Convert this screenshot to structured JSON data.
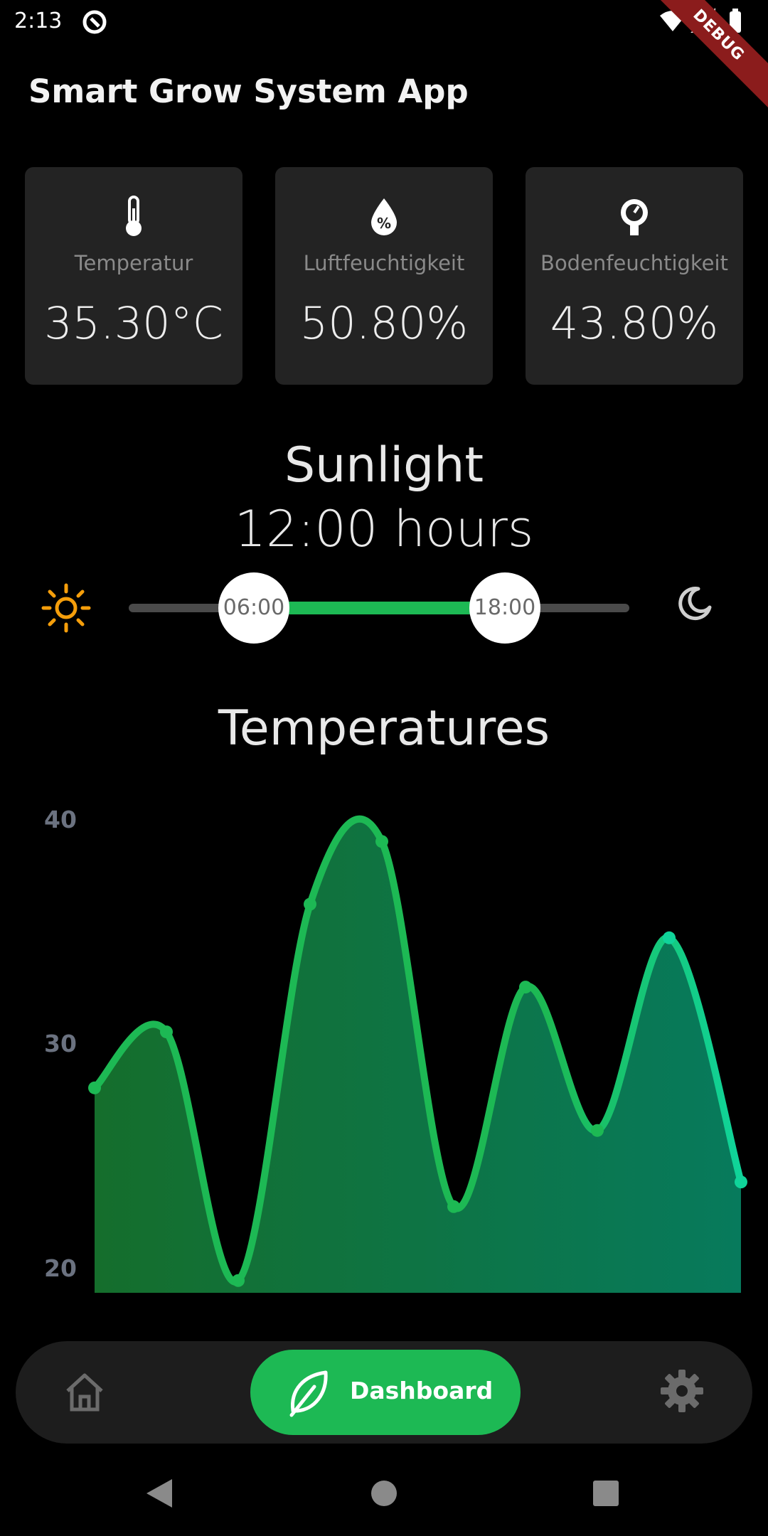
{
  "status_bar": {
    "time": "2:13",
    "debug_label": "DEBUG"
  },
  "app": {
    "title": "Smart Grow System App"
  },
  "cards": [
    {
      "icon": "thermometer-icon",
      "label": "Temperatur",
      "value": "35.30°C"
    },
    {
      "icon": "humidity-drop-icon",
      "label": "Luftfeuchtigkeit",
      "value": "50.80%"
    },
    {
      "icon": "gauge-icon",
      "label": "Bodenfeuchtigkeit",
      "value": "43.80%"
    }
  ],
  "sunlight": {
    "title": "Sunlight",
    "duration": "12:00 hours",
    "start": "06:00",
    "end": "18:00"
  },
  "temperatures": {
    "title": "Temperatures"
  },
  "chart_data": {
    "type": "area",
    "title": "Temperatures",
    "y_ticks": [
      "40",
      "30",
      "20"
    ],
    "ylim": [
      19.5,
      41
    ],
    "x": [
      0,
      1,
      2,
      3,
      4,
      5,
      6,
      7,
      8,
      9
    ],
    "values": [
      28.1,
      30.6,
      19.5,
      36.3,
      39.1,
      22.8,
      32.6,
      26.2,
      34.8,
      23.9
    ],
    "colors": {
      "line_start": "#1db954",
      "line_end": "#10d49a",
      "fill_start": "#156e2c",
      "fill_end": "#077a5c"
    }
  },
  "bottom_nav": {
    "home_icon": "home-icon",
    "dashboard_label": "Dashboard",
    "settings_icon": "gear-icon"
  },
  "colors": {
    "accent": "#1db954",
    "card_bg": "#232323",
    "sun": "#f59e0b"
  }
}
